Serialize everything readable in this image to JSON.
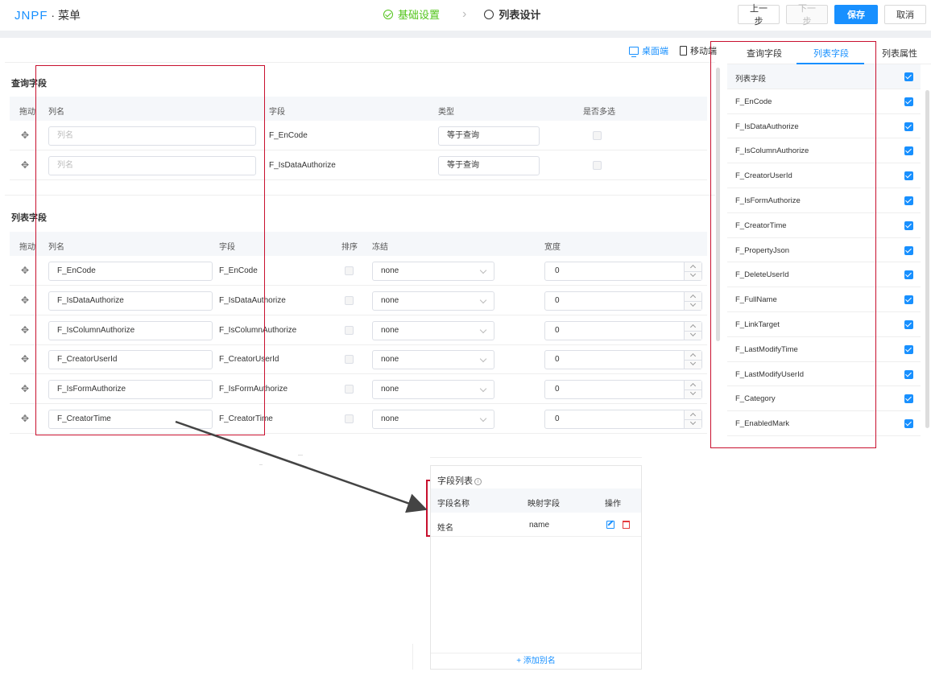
{
  "header": {
    "logo": "JNPF",
    "app_name": "菜单",
    "steps": [
      {
        "label": "基础设置",
        "status": "done"
      },
      {
        "label": "列表设计",
        "status": "current"
      }
    ],
    "buttons": {
      "prev": "上一步",
      "next": "下一步",
      "save": "保存",
      "cancel": "取消"
    }
  },
  "device_switch": {
    "desktop": "桌面端",
    "mobile": "移动端"
  },
  "query_section": {
    "title": "查询字段",
    "columns": {
      "drag": "拖动",
      "name": "列名",
      "field": "字段",
      "type": "类型",
      "multi": "是否多选"
    },
    "rows": [
      {
        "placeholder": "列名",
        "field": "F_EnCode",
        "type": "等于查询"
      },
      {
        "placeholder": "列名",
        "field": "F_IsDataAuthorize",
        "type": "等于查询"
      }
    ]
  },
  "list_section": {
    "title": "列表字段",
    "columns": {
      "drag": "拖动",
      "name": "列名",
      "field": "字段",
      "sort": "排序",
      "freeze": "冻结",
      "width": "宽度"
    },
    "rows": [
      {
        "name": "F_EnCode",
        "field": "F_EnCode",
        "freeze": "none",
        "width": "0"
      },
      {
        "name": "F_IsDataAuthorize",
        "field": "F_IsDataAuthorize",
        "freeze": "none",
        "width": "0"
      },
      {
        "name": "F_IsColumnAuthorize",
        "field": "F_IsColumnAuthorize",
        "freeze": "none",
        "width": "0"
      },
      {
        "name": "F_CreatorUserId",
        "field": "F_CreatorUserId",
        "freeze": "none",
        "width": "0"
      },
      {
        "name": "F_IsFormAuthorize",
        "field": "F_IsFormAuthorize",
        "freeze": "none",
        "width": "0"
      },
      {
        "name": "F_CreatorTime",
        "field": "F_CreatorTime",
        "freeze": "none",
        "width": "0"
      }
    ]
  },
  "right_panel": {
    "tabs": [
      "查询字段",
      "列表字段",
      "列表属性"
    ],
    "active_tab": 1,
    "list_header": "列表字段",
    "items": [
      "F_EnCode",
      "F_IsDataAuthorize",
      "F_IsColumnAuthorize",
      "F_CreatorUserId",
      "F_IsFormAuthorize",
      "F_CreatorTime",
      "F_PropertyJson",
      "F_DeleteUserId",
      "F_FullName",
      "F_LinkTarget",
      "F_LastModifyTime",
      "F_LastModifyUserId",
      "F_Category",
      "F_EnabledMark"
    ]
  },
  "popup": {
    "title": "字段列表",
    "columns": {
      "name": "字段名称",
      "mapping": "映射字段",
      "action": "操作"
    },
    "rows": [
      {
        "name": "姓名",
        "mapping": "name"
      }
    ],
    "add_label": "+ 添加别名"
  },
  "colors": {
    "primary": "#1890ff",
    "success": "#52c41a",
    "highlight": "#c8102e",
    "danger": "#e4393c"
  }
}
